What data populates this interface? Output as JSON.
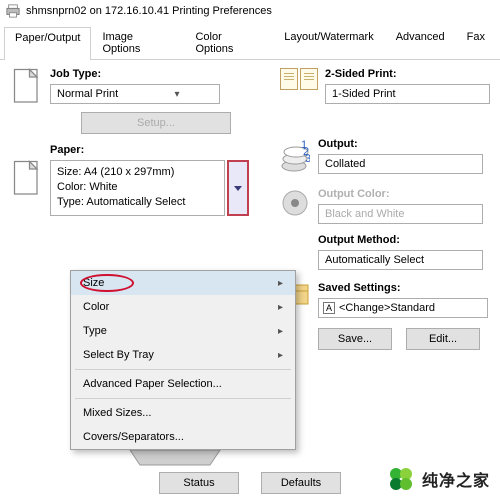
{
  "window": {
    "title": "shmsnprn02 on 172.16.10.41 Printing Preferences"
  },
  "tabs": [
    "Paper/Output",
    "Image Options",
    "Color Options",
    "Layout/Watermark",
    "Advanced",
    "Fax"
  ],
  "active_tab": 0,
  "job": {
    "label": "Job Type:",
    "value": "Normal Print",
    "setup_btn": "Setup..."
  },
  "paper": {
    "label": "Paper:",
    "lines": {
      "size": "Size: A4 (210 x 297mm)",
      "color": "Color: White",
      "type": "Type: Automatically Select"
    }
  },
  "menu": {
    "size": "Size",
    "color": "Color",
    "type": "Type",
    "tray": "Select By Tray",
    "adv": "Advanced Paper Selection...",
    "mixed": "Mixed Sizes...",
    "covers": "Covers/Separators..."
  },
  "two_sided": {
    "label": "2-Sided Print:",
    "value": "1-Sided Print"
  },
  "output": {
    "label": "Output:",
    "value": "Collated"
  },
  "output_color": {
    "label": "Output Color:",
    "value": "Black and White"
  },
  "output_method": {
    "label": "Output Method:",
    "value": "Automatically Select"
  },
  "saved": {
    "label": "Saved Settings:",
    "value": "<Change>Standard",
    "save_btn": "Save...",
    "edit_btn": "Edit..."
  },
  "bottom": {
    "status": "Status",
    "defaults": "Defaults"
  },
  "watermark": "纯净之家"
}
